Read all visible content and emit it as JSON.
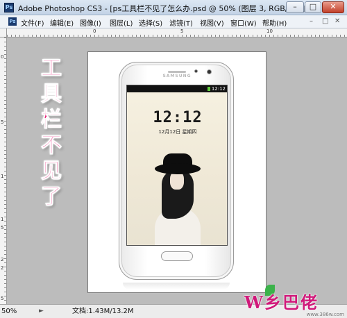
{
  "window": {
    "title": "Adobe Photoshop CS3 - [ps工具栏不见了怎么办.psd @ 50% (图层 3, RGB/8#)]",
    "app_icon": "Ps",
    "minimize": "–",
    "maximize": "□",
    "close": "✕"
  },
  "menu": {
    "items": [
      "文件(F)",
      "编辑(E)",
      "图像(I)",
      "图层(L)",
      "选择(S)",
      "滤镜(T)",
      "视图(V)",
      "窗口(W)",
      "帮助(H)"
    ],
    "mdi_min": "–",
    "mdi_restore": "□",
    "mdi_close": "✕"
  },
  "rulers": {
    "top_marks": [
      "0",
      "5",
      "10"
    ],
    "left_marks": [
      "0",
      "5",
      "1",
      "1",
      "5",
      "2",
      "2",
      "5"
    ]
  },
  "canvas": {
    "overlay_text": "工具栏不见了",
    "overlay_color": "#e8237a",
    "phone": {
      "brand": "SAMSUNG",
      "status_time": "12:12",
      "clock": "12:12",
      "date": "12月12日  星期四"
    }
  },
  "statusbar": {
    "zoom": "50%",
    "doc_info": "文档:1.43M/13.2M",
    "nav_arrow": "►"
  },
  "watermark": {
    "text": "W乡巴佬",
    "url": "www.386w.com",
    "color": "#d0197a"
  }
}
